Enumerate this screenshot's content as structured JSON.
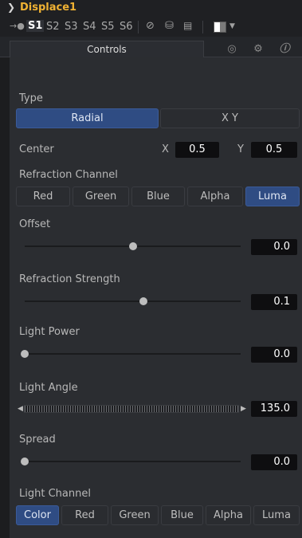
{
  "header": {
    "title": "Displace1",
    "collapse_icon": "chevron-down-icon"
  },
  "toolbar": {
    "pin_icon": "pin-icon",
    "slots": [
      "S1",
      "S2",
      "S3",
      "S4",
      "S5",
      "S6"
    ],
    "active_slot": "S1",
    "disable_icon": "disable-circle-icon",
    "lock_icon": "lock-icon",
    "save_icon": "save-icon",
    "swatch_icon": "color-swatch-icon",
    "dropdown_icon": "chevron-down-icon"
  },
  "tabs": {
    "controls": "Controls",
    "icons": [
      "radio-icon",
      "gear-icon",
      "info-icon"
    ]
  },
  "type": {
    "label": "Type",
    "options": [
      "Radial",
      "X Y"
    ],
    "selected": "Radial"
  },
  "center": {
    "label": "Center",
    "x_label": "X",
    "x_value": "0.5",
    "y_label": "Y",
    "y_value": "0.5"
  },
  "refraction_channel": {
    "label": "Refraction Channel",
    "options": [
      "Red",
      "Green",
      "Blue",
      "Alpha",
      "Luma"
    ],
    "selected": "Luma"
  },
  "offset": {
    "label": "Offset",
    "value": "0.0",
    "slider_fraction": 0.5
  },
  "refraction_strength": {
    "label": "Refraction Strength",
    "value": "0.1",
    "slider_fraction": 0.55
  },
  "light_power": {
    "label": "Light Power",
    "value": "0.0",
    "slider_fraction": 0.0
  },
  "light_angle": {
    "label": "Light Angle",
    "value": "135.0"
  },
  "spread": {
    "label": "Spread",
    "value": "0.0",
    "slider_fraction": 0.0
  },
  "light_channel": {
    "label": "Light Channel",
    "options": [
      "Color",
      "Red",
      "Green",
      "Blue",
      "Alpha",
      "Luma"
    ],
    "selected": "Color"
  },
  "colors": {
    "accent_title": "#f0b233",
    "active_button": "#2f4c83",
    "panel_bg": "#2b2d31"
  }
}
